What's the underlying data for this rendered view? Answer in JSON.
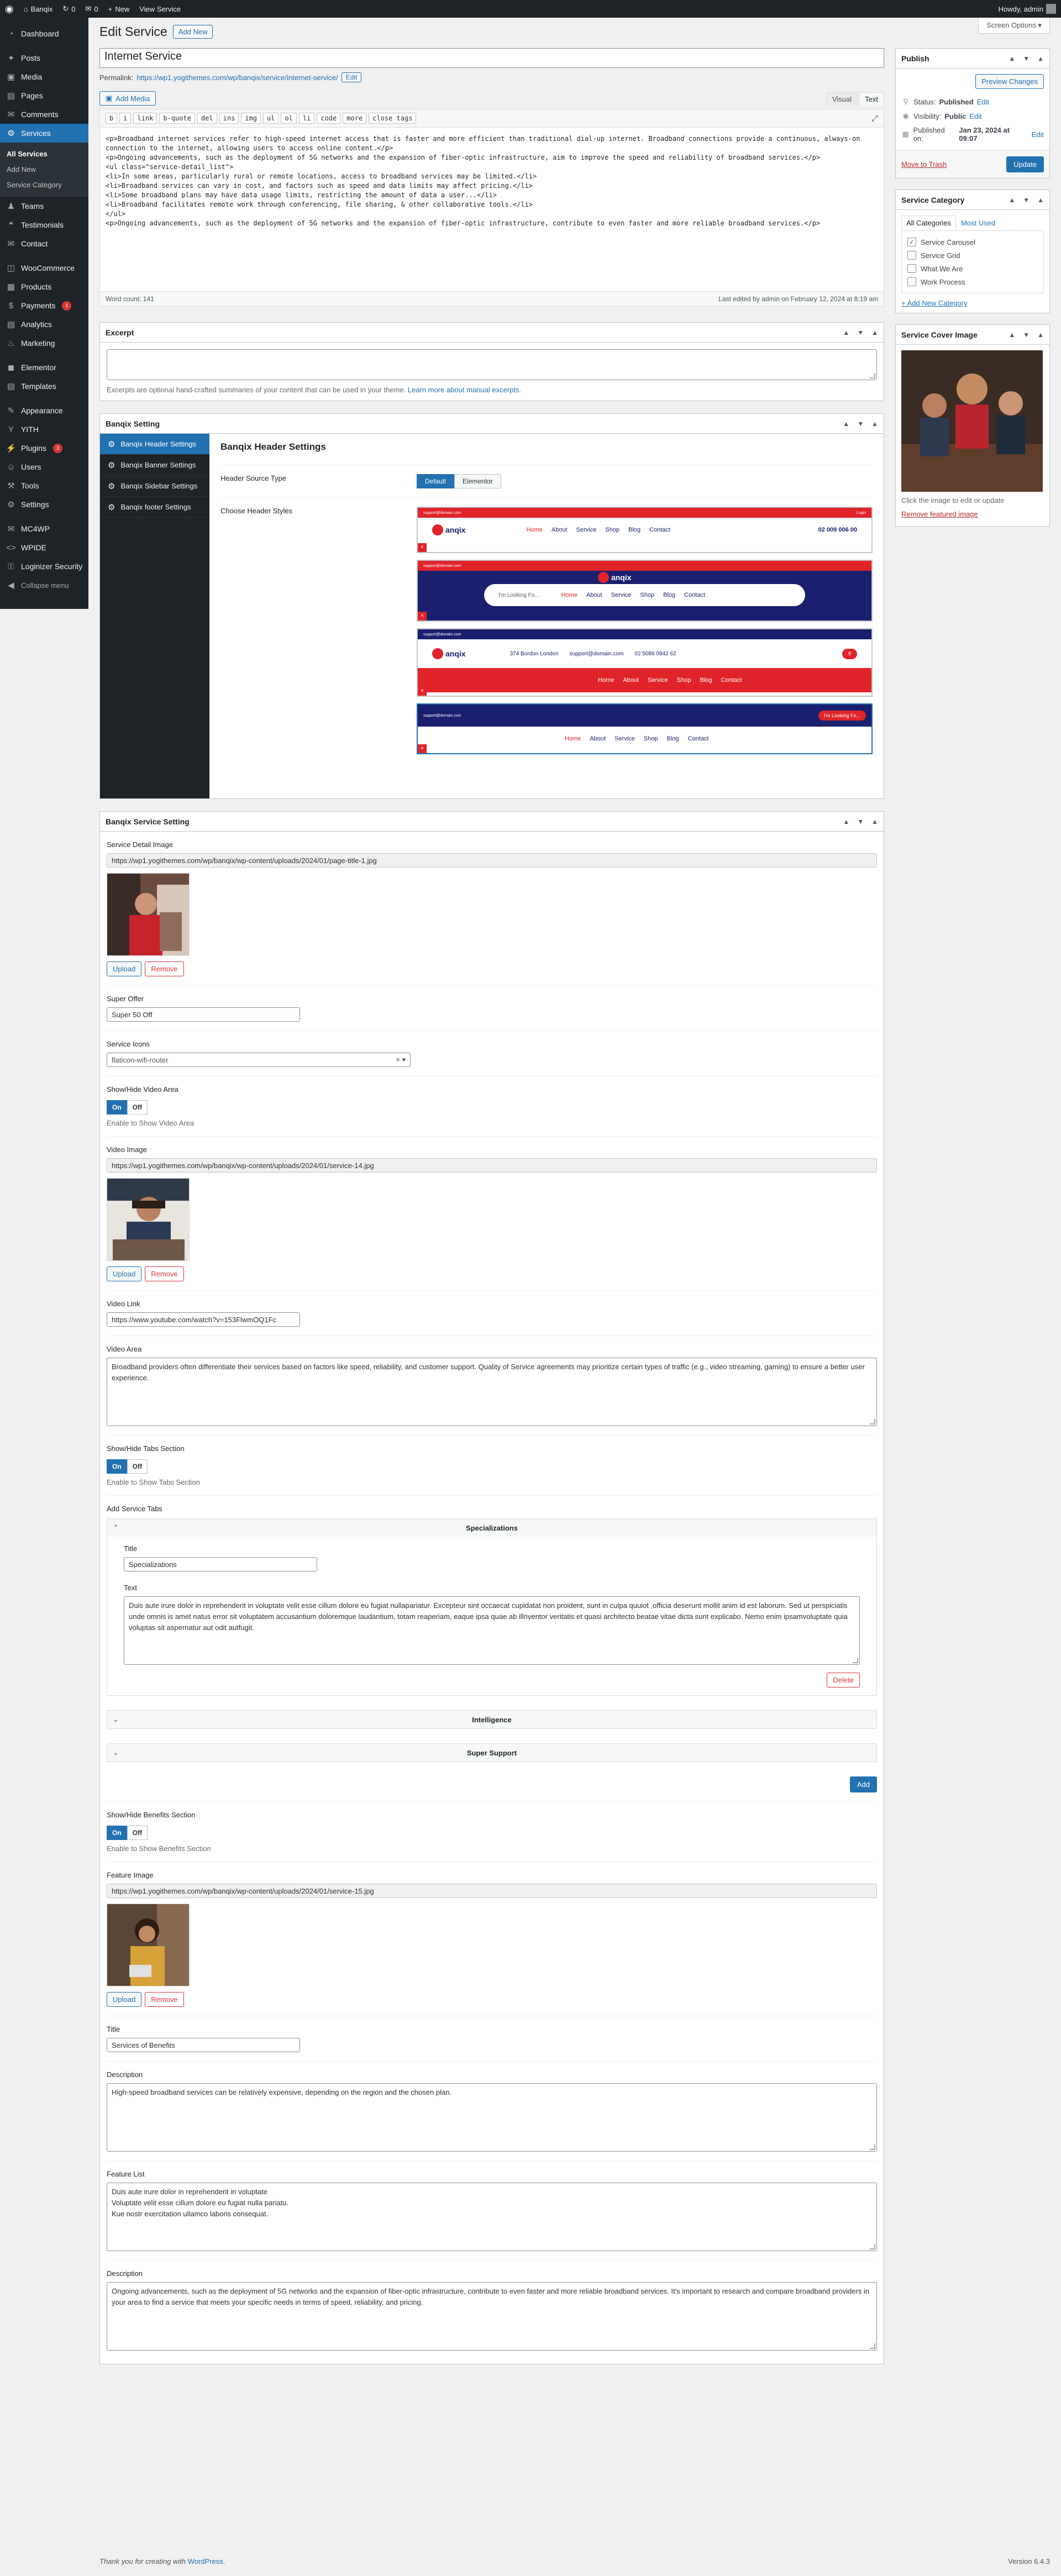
{
  "adminbar": {
    "site_name": "Banqix",
    "updates_count": "0",
    "new_label": "New",
    "view_label": "View Service",
    "howdy": "Howdy, admin"
  },
  "sidebar": {
    "items": [
      {
        "label": "Dashboard",
        "icon": "gauge-icon"
      },
      {
        "label": "Posts",
        "icon": "pin-icon"
      },
      {
        "label": "Media",
        "icon": "media-icon"
      },
      {
        "label": "Pages",
        "icon": "page-icon"
      },
      {
        "label": "Comments",
        "icon": "comment-icon"
      },
      {
        "label": "Services",
        "icon": "services-icon"
      },
      {
        "label": "Teams",
        "icon": "team-icon"
      },
      {
        "label": "Testimonials",
        "icon": "testimonial-icon"
      },
      {
        "label": "Contact",
        "icon": "mail-icon"
      },
      {
        "label": "WooCommerce",
        "icon": "woo-icon"
      },
      {
        "label": "Products",
        "icon": "product-icon"
      },
      {
        "label": "Payments",
        "icon": "payment-icon",
        "badge": "1"
      },
      {
        "label": "Analytics",
        "icon": "chart-icon"
      },
      {
        "label": "Marketing",
        "icon": "megaphone-icon"
      },
      {
        "label": "Elementor",
        "icon": "elementor-icon"
      },
      {
        "label": "Templates",
        "icon": "folder-icon"
      },
      {
        "label": "Appearance",
        "icon": "brush-icon"
      },
      {
        "label": "YITH",
        "icon": "yith-icon"
      },
      {
        "label": "Plugins",
        "icon": "plug-icon",
        "badge": "3"
      },
      {
        "label": "Users",
        "icon": "user-icon"
      },
      {
        "label": "Tools",
        "icon": "wrench-icon"
      },
      {
        "label": "Settings",
        "icon": "settings-icon"
      },
      {
        "label": "MC4WP",
        "icon": "mc4wp-icon"
      },
      {
        "label": "WPIDE",
        "icon": "code-icon"
      },
      {
        "label": "Loginizer Security",
        "icon": "lock-icon"
      }
    ],
    "services_sub": [
      "All Services",
      "Add New",
      "Service Category"
    ],
    "collapse_label": "Collapse menu"
  },
  "header": {
    "title": "Edit Service",
    "add_new": "Add New",
    "screen_options": "Screen Options ▾"
  },
  "post": {
    "title": "Internet Service",
    "permalink_label": "Permalink:",
    "permalink_url": "https://wp1.yogithemes.com/wp/banqix/service/internet-service/",
    "edit_label": "Edit",
    "add_media": "Add Media",
    "tab_visual": "Visual",
    "tab_text": "Text",
    "quicktags": [
      "b",
      "i",
      "link",
      "b-quote",
      "del",
      "ins",
      "img",
      "ul",
      "ol",
      "li",
      "code",
      "more",
      "close tags"
    ],
    "content": "<p>Broadband internet services refer to high-speed internet access that is faster and more efficient than traditional dial-up internet. Broadband connections provide a continuous, always-on connection to the internet, allowing users to access online content.</p>\n<p>Ongoing advancements, such as the deployment of 5G networks and the expansion of fiber-optic infrastructure, aim to improve the speed and reliability of broadband services.</p>\n<ul class=\"service-detail_list\">\n<li>In some areas, particularly rural or remote locations, access to broadband services may be limited.</li>\n<li>Broadband services can vary in cost, and factors such as speed and data limits may affect pricing.</li>\n<li>Some broadband plans may have data usage limits, restricting the amount of data a user...</li>\n<li>Broadband facilitates remote work through conferencing, file sharing, & other collaborative tools.</li>\n</ul>\n<p>Ongoing advancements, such as the deployment of 5G networks and the expansion of fiber-optic infrastructure, contribute to even faster and more reliable broadband services.</p>",
    "word_count": "Word count: 141",
    "last_edited": "Last edited by admin on February 12, 2024 at 8:19 am"
  },
  "excerpt": {
    "title": "Excerpt",
    "value": "",
    "hint_pre": "Excerpts are optional hand-crafted summaries of your content that can be used in your theme.",
    "hint_link": "Learn more about manual excerpts"
  },
  "banqix_setting": {
    "title": "Banqix Setting",
    "nav": [
      "Banqix Header Settings",
      "Banqix Banner Settings",
      "Banqix Sidebar Settings",
      "Banqix footer Settings"
    ],
    "content_title": "Banqix Header Settings",
    "source_label": "Header Source Type",
    "source_options": [
      "Default",
      "Elementor"
    ],
    "styles_label": "Choose Header Styles",
    "preview": {
      "logo": "anqix",
      "nav": [
        "Home",
        "About",
        "Service",
        "Shop",
        "Blog",
        "Contact"
      ],
      "nav_alt": [
        "Home",
        "About",
        "Service",
        "Shop",
        "Blog",
        "Contact"
      ],
      "looking": "I'm Looking Fo...",
      "address_label": "374 Bordon London",
      "phone_label": "02 5089 0942 62",
      "phone_alt": "02 009 006 00",
      "email_label": "support@domain.com",
      "login": "Login",
      "colors": {
        "red": "#e0242a",
        "navy": "#1a1f6e",
        "white": "#ffffff",
        "blue": "#2271b1"
      }
    }
  },
  "service_setting": {
    "title": "Banqix Service Setting",
    "detail_image_label": "Service Detail Image",
    "detail_image_url": "https://wp1.yogithemes.com/wp/banqix/wp-content/uploads/2024/01/page-title-1.jpg",
    "upload": "Upload",
    "remove": "Remove",
    "super_offer_label": "Super Offer",
    "super_offer_value": "Super 50 Off",
    "icons_label": "Service Icons",
    "icons_value": "flaticon-wifi-router",
    "video_area_toggle_label": "Show/Hide Video Area",
    "on": "On",
    "off": "Off",
    "video_area_hint": "Enable to Show Video Area",
    "video_image_label": "Video Image",
    "video_image_url": "https://wp1.yogithemes.com/wp/banqix/wp-content/uploads/2024/01/service-14.jpg",
    "video_link_label": "Video Link",
    "video_link_value": "https://www.youtube.com/watch?v=153FlwmOQ1Fc",
    "video_area_label": "Video Area",
    "video_area_value": "Broadband providers often differentiate their services based on factors like speed, reliability, and customer support. Quality of Service agreements may prioritize certain types of traffic (e.g., video streaming, gaming) to ensure a better user experience.",
    "tabs_toggle_label": "Show/Hide Tabs Section",
    "tabs_hint": "Enable to Show Tabs Section",
    "add_tabs_label": "Add Service Tabs",
    "tabs": [
      {
        "name": "Specializations",
        "title_label": "Title",
        "title_value": "Specializations",
        "text_label": "Text",
        "text_value": "Duis aute irure dolor in reprehenderit in voluptate velit esse cillum dolore eu fugiat nullapariatur. Excepteur sint occaecat cupidatat non proident, sunt in culpa quuiot ,officia deserunt mollit anim id est laborum. Sed ut perspiciatis unde omnis is amet natus error sit voluptatem accusantium doloremque laudantium, totam reaperiam, eaque ipsa quae ab illnventor veritatis et quasi architecto beatae vitae dicta sunt explicabo. Nemo enim ipsamvoluptate quia voluptas sit aspernatur aut odit autfugit."
      },
      {
        "name": "Intelligence"
      },
      {
        "name": "Super Support"
      }
    ],
    "delete": "Delete",
    "add": "Add",
    "benefits_toggle_label": "Show/Hide Benefits Section",
    "benefits_hint": "Enable to Show Benefits Section",
    "feature_image_label": "Feature Image",
    "feature_image_url": "https://wp1.yogithemes.com/wp/banqix/wp-content/uploads/2024/01/service-15.jpg",
    "title_label": "Title",
    "title_value": "Services of Benefits",
    "description_label": "Description",
    "description_value": "High-speed broadband services can be relatively expensive, depending on the region and the chosen plan.",
    "feature_list_label": "Feature List",
    "feature_list": [
      "Duis aute irure dolor in reprehenderit in voluptate",
      "Voluptate velit esse cillum dolore eu fugiat nulla pariatu.",
      "Kue nostr exercitation ullamco laboris consequat."
    ],
    "description2_label": "Description",
    "description2_value": "Ongoing advancements, such as the deployment of 5G networks and the expansion of fiber-optic infrastructure, contribute to even faster and more reliable broadband services. It's important to research and compare broadband providers in your area to find a service that meets your specific needs in terms of speed, reliability, and pricing."
  },
  "publish": {
    "title": "Publish",
    "preview": "Preview Changes",
    "status_label": "Status:",
    "status_value": "Published",
    "visibility_label": "Visibility:",
    "visibility_value": "Public",
    "published_label": "Published on:",
    "published_value": "Jan 23, 2024 at 09:07",
    "edit": "Edit",
    "trash": "Move to Trash",
    "update": "Update"
  },
  "category": {
    "title": "Service Category",
    "tab_all": "All Categories",
    "tab_most": "Most Used",
    "items": [
      {
        "label": "Service Carousel",
        "checked": true
      },
      {
        "label": "Service Grid",
        "checked": false
      },
      {
        "label": "What We Are",
        "checked": false
      },
      {
        "label": "Work Process",
        "checked": false
      }
    ],
    "add_new": "+ Add New Category"
  },
  "cover": {
    "title": "Service Cover Image",
    "hint": "Click the image to edit or update",
    "remove": "Remove featured image"
  },
  "footer": {
    "thanks_pre": "Thank you for creating with",
    "thanks_link": "WordPress",
    "version": "Version 6.4.3"
  }
}
